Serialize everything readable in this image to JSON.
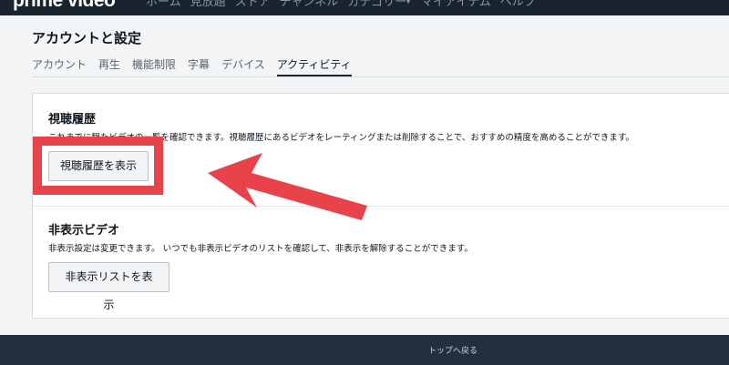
{
  "nav": {
    "logo": "prime video",
    "items": [
      "ホーム",
      "見放題",
      "ストア",
      "チャンネル",
      "カテゴリー",
      "マイアイテム",
      "ヘルプ"
    ]
  },
  "page_title": "アカウントと設定",
  "tabs": [
    "アカウント",
    "再生",
    "機能制限",
    "字幕",
    "デバイス",
    "アクティビティ"
  ],
  "active_tab": "アクティビティ",
  "watch_history": {
    "title": "視聴履歴",
    "description": "これまでに観たビデオの一覧を確認できます。視聴履歴にあるビデオをレーティングまたは削除することで、おすすめの精度を高めることができます。",
    "button": "視聴履歴を表示"
  },
  "hidden_videos": {
    "title": "非表示ビデオ",
    "description": "非表示設定は変更できます。 いつでも非表示ビデオのリストを確認して、非表示を解除することができます。",
    "button": "非表示リストを表示"
  },
  "footer": {
    "back_to_top": "トップへ戻る"
  },
  "annotation": {
    "color": "#e8434a"
  }
}
